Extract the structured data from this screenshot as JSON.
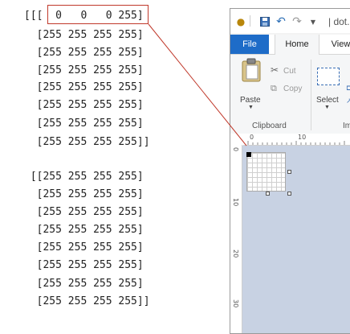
{
  "array_printout": {
    "lines": [
      "[[[  0   0   0 255]",
      "  [255 255 255 255]",
      "  [255 255 255 255]",
      "  [255 255 255 255]",
      "  [255 255 255 255]",
      "  [255 255 255 255]",
      "  [255 255 255 255]",
      "  [255 255 255 255]]",
      "",
      " [[255 255 255 255]",
      "  [255 255 255 255]",
      "  [255 255 255 255]",
      "  [255 255 255 255]",
      "  [255 255 255 255]",
      "  [255 255 255 255]",
      "  [255 255 255 255]",
      "  [255 255 255 255]]"
    ]
  },
  "paint": {
    "title": "| dot.p",
    "tabs": {
      "file": "File",
      "home": "Home",
      "view": "View"
    },
    "clipboard": {
      "paste": "Paste",
      "cut": "Cut",
      "copy": "Copy",
      "group_label": "Clipboard"
    },
    "image": {
      "select": "Select",
      "group_label": "Im"
    },
    "ruler_top": [
      "0",
      "10"
    ],
    "ruler_left": [
      "0",
      "10",
      "20",
      "30"
    ]
  },
  "colors": {
    "accent": "#1e6cc8",
    "highlight": "#c0392b",
    "workspace": "#c8d2e3"
  }
}
